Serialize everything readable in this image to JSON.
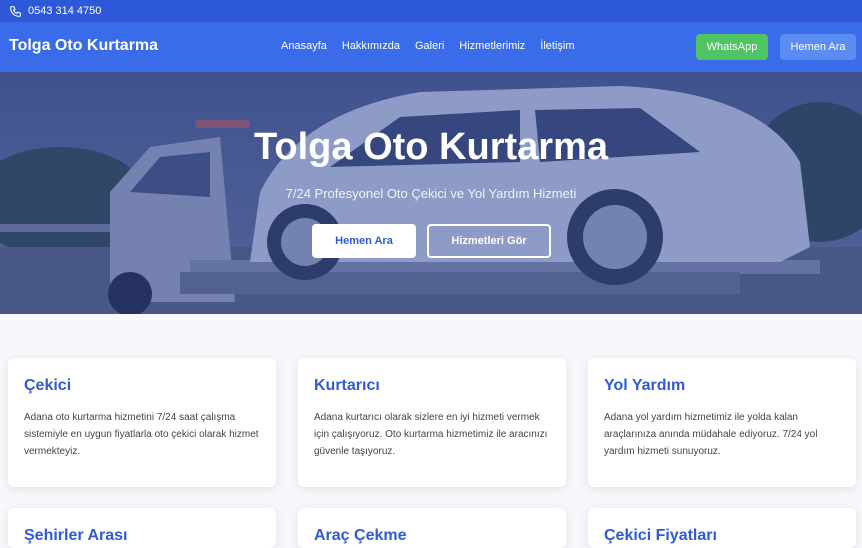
{
  "topbar": {
    "phone": "0543 314 4750",
    "icon": "phone-icon"
  },
  "navbar": {
    "brand": "Tolga Oto Kurtarma",
    "links": [
      "Anasayfa",
      "Hakkımızda",
      "Galeri",
      "Hizmetlerimiz",
      "İletişim"
    ],
    "whatsapp_label": "WhatsApp",
    "call_label": "Hemen Ara"
  },
  "hero": {
    "title": "Tolga Oto Kurtarma",
    "subtitle": "7/24 Profesyonel Oto Çekici ve Yol Yardım Hizmeti",
    "primary_button": "Hemen Ara",
    "secondary_button": "Hizmetleri Gör"
  },
  "services": [
    {
      "title": "Çekici",
      "text": "Adana oto kurtarma hizmetini 7/24 saat çalışma sistemiyle en uygun fiyatlarla oto çekici olarak hizmet vermekteyiz."
    },
    {
      "title": "Kurtarıcı",
      "text": "Adana kurtarıcı olarak sizlere en iyi hizmeti vermek için çalışıyoruz. Oto kurtarma hizmetimiz ile aracınızı güvenle taşıyoruz."
    },
    {
      "title": "Yol Yardım",
      "text": "Adana yol yardım hizmetimiz ile yolda kalan araçlarınıza anında müdahale ediyoruz. 7/24 yol yardım hizmeti sunuyoruz."
    },
    {
      "title": "Şehirler Arası"
    },
    {
      "title": "Araç Çekme"
    },
    {
      "title": "Çekici Fiyatları"
    }
  ],
  "colors": {
    "primary": "#3a6be8",
    "topbar": "#2c58d9",
    "whatsapp": "#4fc463",
    "heading": "#2f5bd6"
  }
}
